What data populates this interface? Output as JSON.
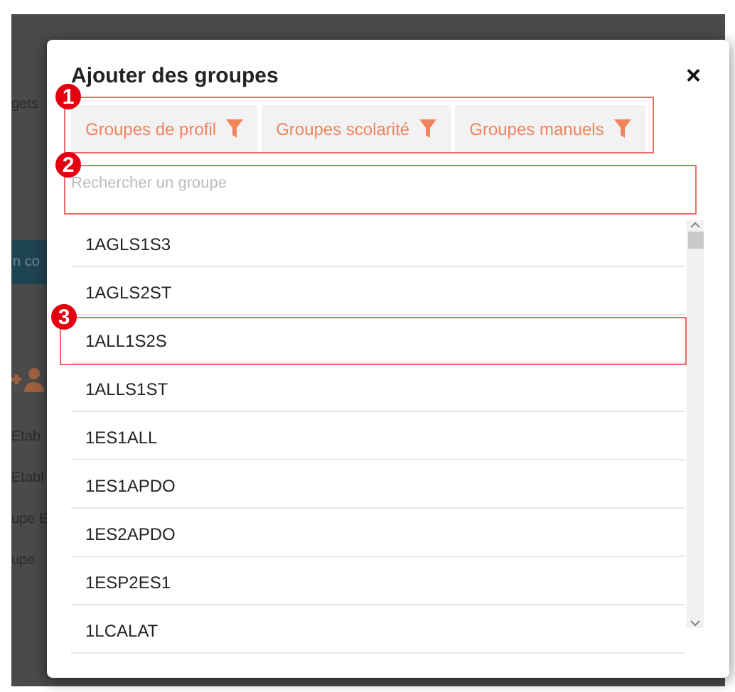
{
  "background": {
    "fragments": [
      {
        "text": "gets",
        "kind": "tab"
      },
      {
        "text": "n co",
        "kind": "band"
      },
      {
        "text": "Etab",
        "kind": "line"
      },
      {
        "text": "Etabl",
        "kind": "line"
      },
      {
        "text": "upe E",
        "kind": "line"
      },
      {
        "text": "upe",
        "kind": "line"
      }
    ]
  },
  "dialog": {
    "title": "Ajouter des groupes",
    "close": "×"
  },
  "filter_bar": {
    "callout": "1",
    "buttons": [
      {
        "label": "Groupes de profil"
      },
      {
        "label": "Groupes scolarité"
      },
      {
        "label": "Groupes manuels"
      }
    ]
  },
  "search": {
    "placeholder": "Rechercher un groupe",
    "callout": "2"
  },
  "groups": [
    {
      "name": "1AGLS1S3"
    },
    {
      "name": "1AGLS2ST"
    },
    {
      "name": "1ALL1S2S",
      "callout": "3"
    },
    {
      "name": "1ALLS1ST"
    },
    {
      "name": "1ES1ALL"
    },
    {
      "name": "1ES1APDO"
    },
    {
      "name": "1ES2APDO"
    },
    {
      "name": "1ESP2ES1"
    },
    {
      "name": "1LCALAT"
    }
  ]
}
